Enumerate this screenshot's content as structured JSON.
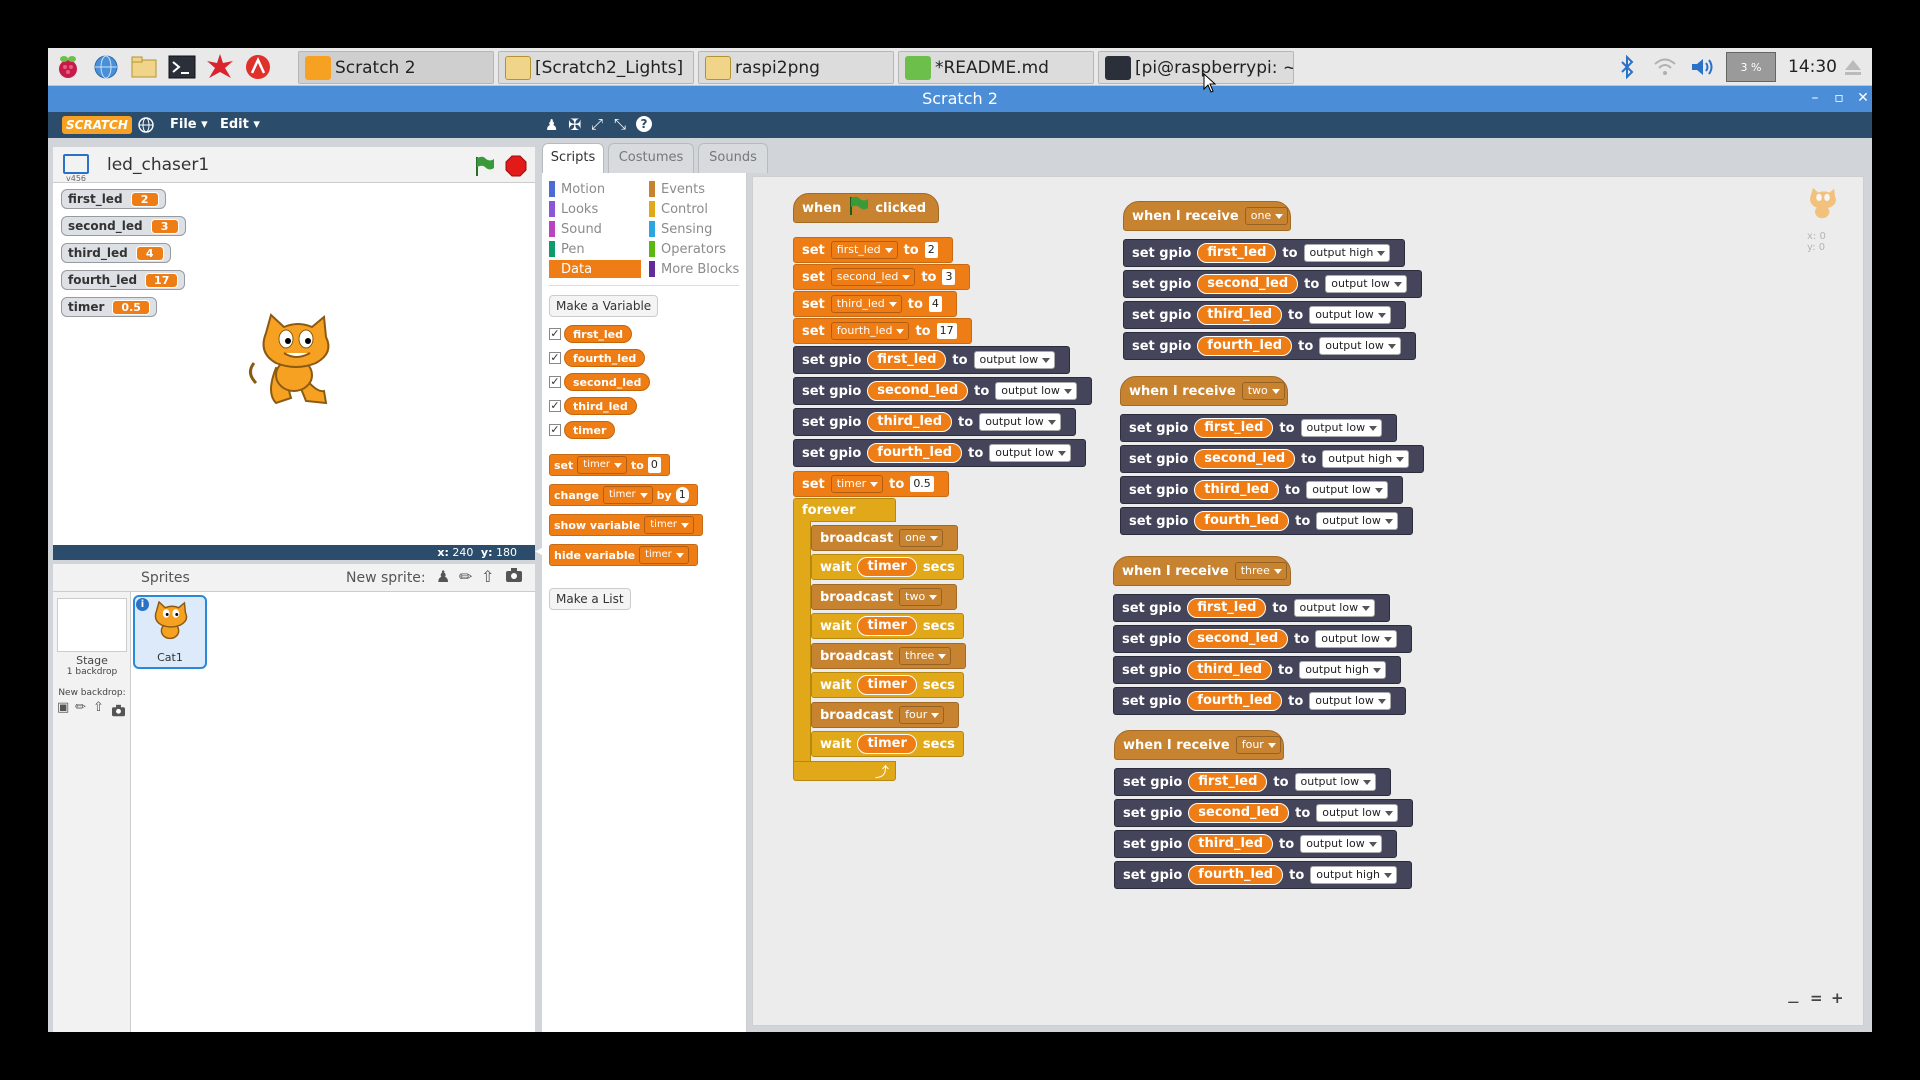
{
  "taskbar": {
    "windows": [
      "Scratch 2",
      "[Scratch2_Lights]",
      "raspi2png",
      "*README.md",
      "[pi@raspberrypi: ~/ra..."
    ],
    "cpu": "3 %",
    "clock": "14:30"
  },
  "window": {
    "title": "Scratch 2"
  },
  "menu": {
    "file": "File",
    "edit": "Edit",
    "logo": "SCRATCH"
  },
  "stage": {
    "project_title": "led_chaser1",
    "version": "v456",
    "coords_x_label": "x:",
    "coords_x": "240",
    "coords_y_label": "y:",
    "coords_y": "180",
    "monitors": [
      {
        "name": "first_led",
        "value": "2"
      },
      {
        "name": "second_led",
        "value": "3"
      },
      {
        "name": "third_led",
        "value": "4"
      },
      {
        "name": "fourth_led",
        "value": "17"
      },
      {
        "name": "timer",
        "value": "0.5"
      }
    ]
  },
  "sprites": {
    "header": "Sprites",
    "new_sprite": "New sprite:",
    "stage_label": "Stage",
    "stage_sub": "1 backdrop",
    "new_backdrop": "New backdrop:",
    "sprite_name": "Cat1"
  },
  "tabs": [
    "Scripts",
    "Costumes",
    "Sounds"
  ],
  "categories": {
    "left": [
      {
        "label": "Motion",
        "color": "#4a6cd4"
      },
      {
        "label": "Looks",
        "color": "#8a55d7"
      },
      {
        "label": "Sound",
        "color": "#bb42c3"
      },
      {
        "label": "Pen",
        "color": "#0e9a6c"
      },
      {
        "label": "Data",
        "color": "#ee7d16"
      }
    ],
    "right": [
      {
        "label": "Events",
        "color": "#c88330"
      },
      {
        "label": "Control",
        "color": "#e1a91a"
      },
      {
        "label": "Sensing",
        "color": "#2ca5e2"
      },
      {
        "label": "Operators",
        "color": "#5cb712"
      },
      {
        "label": "More Blocks",
        "color": "#632d99"
      }
    ]
  },
  "palette": {
    "make_variable": "Make a Variable",
    "make_list": "Make a List",
    "variables": [
      "first_led",
      "fourth_led",
      "second_led",
      "third_led",
      "timer"
    ],
    "set_block": {
      "kw": "set",
      "var": "timer",
      "to": "to",
      "val": "0"
    },
    "change_block": {
      "kw": "change",
      "var": "timer",
      "by": "by",
      "val": "1"
    },
    "show_block": {
      "kw": "show variable",
      "var": "timer"
    },
    "hide_block": {
      "kw": "hide variable",
      "var": "timer"
    }
  },
  "scripts": {
    "main": {
      "hat": {
        "when": "when",
        "clicked": "clicked"
      },
      "sets": [
        {
          "kw": "set",
          "var": "first_led",
          "to": "to",
          "val": "2"
        },
        {
          "kw": "set",
          "var": "second_led",
          "to": "to",
          "val": "3"
        },
        {
          "kw": "set",
          "var": "third_led",
          "to": "to",
          "val": "4"
        },
        {
          "kw": "set",
          "var": "fourth_led",
          "to": "to",
          "val": "17"
        }
      ],
      "gpios": [
        {
          "kw": "set gpio",
          "var": "first_led",
          "to": "to",
          "mode": "output low"
        },
        {
          "kw": "set gpio",
          "var": "second_led",
          "to": "to",
          "mode": "output low"
        },
        {
          "kw": "set gpio",
          "var": "third_led",
          "to": "to",
          "mode": "output low"
        },
        {
          "kw": "set gpio",
          "var": "fourth_led",
          "to": "to",
          "mode": "output low"
        }
      ],
      "set_timer": {
        "kw": "set",
        "var": "timer",
        "to": "to",
        "val": "0.5"
      },
      "forever": "forever",
      "loop": [
        {
          "type": "broadcast",
          "kw": "broadcast",
          "msg": "one"
        },
        {
          "type": "wait",
          "kw": "wait",
          "var": "timer",
          "unit": "secs"
        },
        {
          "type": "broadcast",
          "kw": "broadcast",
          "msg": "two"
        },
        {
          "type": "wait",
          "kw": "wait",
          "var": "timer",
          "unit": "secs"
        },
        {
          "type": "broadcast",
          "kw": "broadcast",
          "msg": "three"
        },
        {
          "type": "wait",
          "kw": "wait",
          "var": "timer",
          "unit": "secs"
        },
        {
          "type": "broadcast",
          "kw": "broadcast",
          "msg": "four"
        },
        {
          "type": "wait",
          "kw": "wait",
          "var": "timer",
          "unit": "secs"
        }
      ]
    },
    "receivers": [
      {
        "hat_kw": "when I receive",
        "msg": "one",
        "rows": [
          {
            "kw": "set gpio",
            "var": "first_led",
            "to": "to",
            "mode": "output high"
          },
          {
            "kw": "set gpio",
            "var": "second_led",
            "to": "to",
            "mode": "output low"
          },
          {
            "kw": "set gpio",
            "var": "third_led",
            "to": "to",
            "mode": "output low"
          },
          {
            "kw": "set gpio",
            "var": "fourth_led",
            "to": "to",
            "mode": "output low"
          }
        ]
      },
      {
        "hat_kw": "when I receive",
        "msg": "two",
        "rows": [
          {
            "kw": "set gpio",
            "var": "first_led",
            "to": "to",
            "mode": "output low"
          },
          {
            "kw": "set gpio",
            "var": "second_led",
            "to": "to",
            "mode": "output high"
          },
          {
            "kw": "set gpio",
            "var": "third_led",
            "to": "to",
            "mode": "output low"
          },
          {
            "kw": "set gpio",
            "var": "fourth_led",
            "to": "to",
            "mode": "output low"
          }
        ]
      },
      {
        "hat_kw": "when I receive",
        "msg": "three",
        "rows": [
          {
            "kw": "set gpio",
            "var": "first_led",
            "to": "to",
            "mode": "output low"
          },
          {
            "kw": "set gpio",
            "var": "second_led",
            "to": "to",
            "mode": "output low"
          },
          {
            "kw": "set gpio",
            "var": "third_led",
            "to": "to",
            "mode": "output high"
          },
          {
            "kw": "set gpio",
            "var": "fourth_led",
            "to": "to",
            "mode": "output low"
          }
        ]
      },
      {
        "hat_kw": "when I receive",
        "msg": "four",
        "rows": [
          {
            "kw": "set gpio",
            "var": "first_led",
            "to": "to",
            "mode": "output low"
          },
          {
            "kw": "set gpio",
            "var": "second_led",
            "to": "to",
            "mode": "output low"
          },
          {
            "kw": "set gpio",
            "var": "third_led",
            "to": "to",
            "mode": "output low"
          },
          {
            "kw": "set gpio",
            "var": "fourth_led",
            "to": "to",
            "mode": "output high"
          }
        ]
      }
    ],
    "sprite_x_label": "x:",
    "sprite_x": "0",
    "sprite_y_label": "y:",
    "sprite_y": "0"
  }
}
